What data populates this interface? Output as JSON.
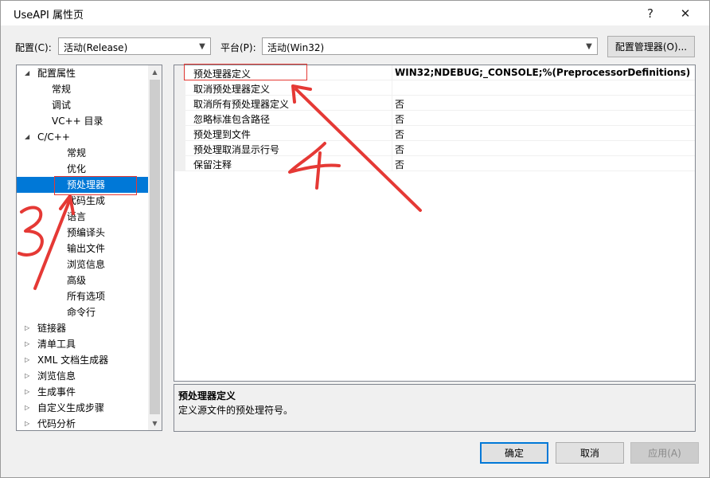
{
  "window": {
    "title": "UseAPI 属性页",
    "help_label": "?",
    "close_label": "✕"
  },
  "config": {
    "config_label": "配置(C):",
    "config_value": "活动(Release)",
    "platform_label": "平台(P):",
    "platform_value": "活动(Win32)",
    "manager_label": "配置管理器(O)..."
  },
  "tree": {
    "items": [
      {
        "label": "配置属性",
        "tw": "◢"
      },
      {
        "label": "常规"
      },
      {
        "label": "调试"
      },
      {
        "label": "VC++ 目录"
      },
      {
        "label": "C/C++",
        "tw": "◢"
      },
      {
        "label": "常规"
      },
      {
        "label": "优化"
      },
      {
        "label": "预处理器"
      },
      {
        "label": "代码生成"
      },
      {
        "label": "语言"
      },
      {
        "label": "预编译头"
      },
      {
        "label": "输出文件"
      },
      {
        "label": "浏览信息"
      },
      {
        "label": "高级"
      },
      {
        "label": "所有选项"
      },
      {
        "label": "命令行"
      },
      {
        "label": "链接器",
        "tw": "▷"
      },
      {
        "label": "清单工具",
        "tw": "▷"
      },
      {
        "label": "XML 文档生成器",
        "tw": "▷"
      },
      {
        "label": "浏览信息",
        "tw": "▷"
      },
      {
        "label": "生成事件",
        "tw": "▷"
      },
      {
        "label": "自定义生成步骤",
        "tw": "▷"
      },
      {
        "label": "代码分析",
        "tw": "▷"
      }
    ]
  },
  "properties": [
    {
      "name": "预处理器定义",
      "value": "WIN32;NDEBUG;_CONSOLE;%(PreprocessorDefinitions)"
    },
    {
      "name": "取消预处理器定义",
      "value": ""
    },
    {
      "name": "取消所有预处理器定义",
      "value": "否"
    },
    {
      "name": "忽略标准包含路径",
      "value": "否"
    },
    {
      "name": "预处理到文件",
      "value": "否"
    },
    {
      "name": "预处理取消显示行号",
      "value": "否"
    },
    {
      "name": "保留注释",
      "value": "否"
    }
  ],
  "description": {
    "title": "预处理器定义",
    "text": "定义源文件的预处理符号。"
  },
  "buttons": {
    "ok": "确定",
    "cancel": "取消",
    "apply": "应用(A)"
  },
  "annotations": {
    "red_color": "#e53935"
  }
}
